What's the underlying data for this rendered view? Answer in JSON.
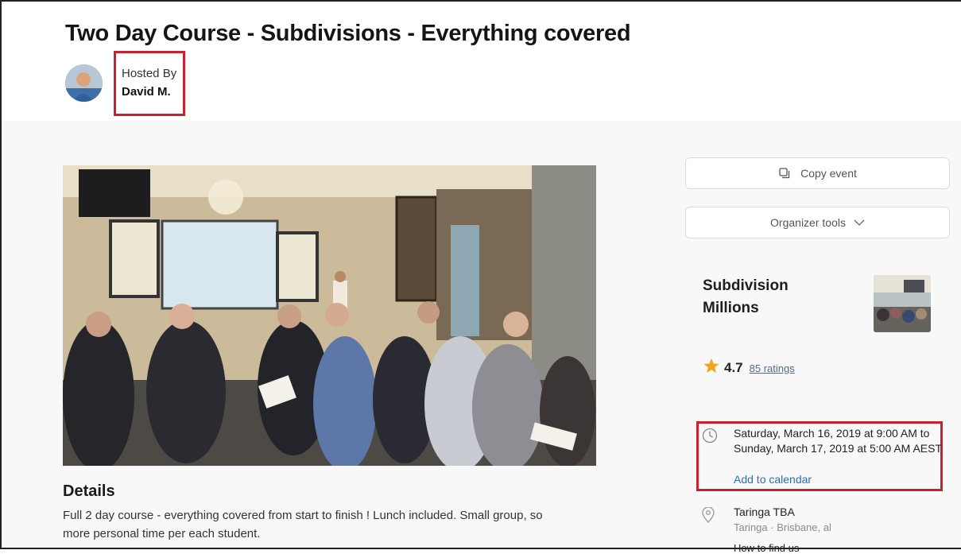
{
  "event": {
    "title": "Two Day Course - Subdivisions - Everything covered",
    "hosted_by_label": "Hosted By",
    "host_name": "David M."
  },
  "details": {
    "heading": "Details",
    "text": "Full 2 day course - everything covered from start to finish ! Lunch included. Small group, so more personal time per each student."
  },
  "sidebar": {
    "copy_event_label": "Copy event",
    "organizer_tools_label": "Organizer tools",
    "group": {
      "name": "Subdivision Millions",
      "rating": "4.7",
      "ratings_count": "85 ratings"
    },
    "datetime": {
      "text": "Saturday, March 16, 2019 at 9:00 AM to Sunday, March 17, 2019 at 5:00 AM AEST",
      "add_to_calendar": "Add to calendar"
    },
    "location": {
      "name": "Taringa TBA",
      "sub": "Taringa · Brisbane, al",
      "how_to_find": "How to find us"
    }
  },
  "icons": {
    "copy": "copy-icon",
    "chevron": "chevron-down-icon",
    "star": "star-icon",
    "clock": "clock-icon",
    "pin": "location-pin-icon"
  },
  "colors": {
    "highlight_box": "#c8222f",
    "link": "#2b6fb6",
    "star": "#f2a51a"
  }
}
